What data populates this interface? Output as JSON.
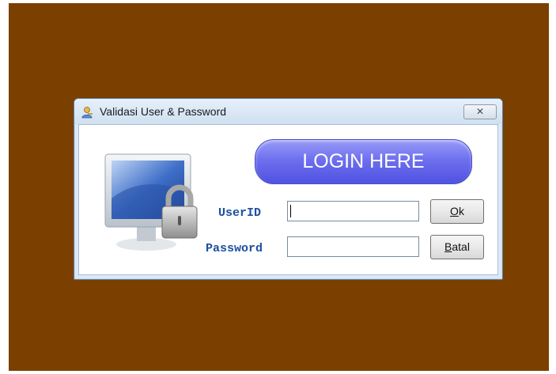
{
  "window": {
    "title": "Validasi User & Password",
    "close_label": "✕"
  },
  "banner": {
    "text": "LOGIN HERE",
    "color": "#6264ea"
  },
  "form": {
    "userid_label": "UserID",
    "password_label": "Password",
    "userid_value": "",
    "password_value": ""
  },
  "buttons": {
    "ok": {
      "accel": "O",
      "rest": "k"
    },
    "batal": {
      "accel": "B",
      "rest": "atal"
    }
  },
  "icons": {
    "title": "key-person-icon",
    "art": "monitor-padlock-icon"
  },
  "colors": {
    "desktop": "#7b3f00",
    "label": "#1c4ea0"
  }
}
